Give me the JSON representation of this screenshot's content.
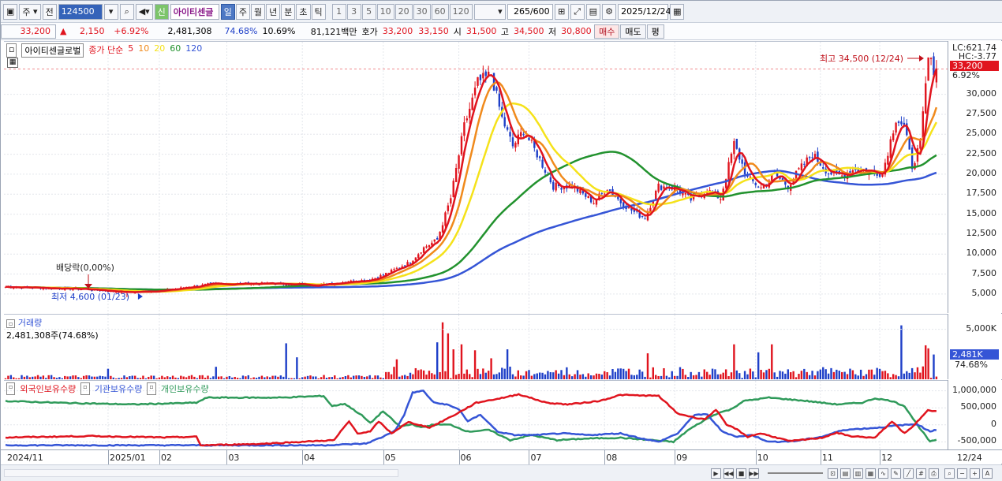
{
  "toolbar": {
    "kind_label": "주",
    "prev_label": "전",
    "code_value": "124500",
    "new_label": "신",
    "stock_name": "아이티센글",
    "periods": [
      "일",
      "주",
      "월",
      "년",
      "분",
      "초",
      "틱"
    ],
    "active_period": "일",
    "intervals": [
      "1",
      "3",
      "5",
      "10",
      "20",
      "30",
      "60",
      "120"
    ],
    "count_value": "265",
    "count_total": "/600",
    "date_value": "2025/12/24"
  },
  "quote": {
    "price": "33,200",
    "change_arrow": "▲",
    "change": "2,150",
    "change_pct": "+6.92%",
    "volume": "2,481,308",
    "vol_ratio": "74.68%",
    "turnover": "10.69%",
    "amount": "81,121백만",
    "hoga_label": "호가",
    "hoga_ask": "33,200",
    "hoga_bid": "33,150",
    "open_label": "시",
    "open": "31,500",
    "high_label": "고",
    "high": "34,500",
    "low_label": "저",
    "low": "30,800",
    "buy_label": "매수",
    "sell_label": "매도",
    "eval_label": "평"
  },
  "price_panel": {
    "title": "아이티센글로벌",
    "ma_prefix": "종가 단순",
    "ma_periods": [
      "5",
      "10",
      "20",
      "60",
      "120"
    ],
    "high_annotation": "최고 34,500 (12/24)",
    "low_annotation": "최저 4,600 (01/23)",
    "dividend_annotation": "배당락(0,00%)",
    "lc_label": "LC:621.74",
    "hc_label": "HC:-3.77",
    "last_price_badge": "33,200",
    "last_pct_badge": "6.92%"
  },
  "volume_panel": {
    "title": "거래량",
    "subtitle": "2,481,308주(74.68%)",
    "last_badge": "2,481K",
    "last_pct": "74.68%"
  },
  "holding_panel": {
    "legend": [
      "외국인보유수량",
      "기관보유수량",
      "개인보유수량"
    ]
  },
  "x_labels": [
    "2024/11",
    "2025/01",
    "02",
    "03",
    "04",
    "05",
    "06",
    "07",
    "08",
    "09",
    "10",
    "11",
    "12"
  ],
  "x_axis_right": "12/24",
  "colors": {
    "up": "#e0141e",
    "down": "#1e3fc8",
    "ma5": "#e0141e",
    "ma10": "#f08a1c",
    "ma20": "#f5e21a",
    "ma60": "#22922e",
    "ma120": "#3555d6",
    "foreign": "#e0141e",
    "inst": "#3555d6",
    "retail": "#2f9a5a"
  },
  "chart_data": {
    "type": "candlestick",
    "y_ticks": [
      5000,
      7500,
      10000,
      12500,
      15000,
      17500,
      20000,
      22500,
      25000,
      27500,
      30000
    ],
    "y_tick_labels": [
      "5,000",
      "7,500",
      "10,000",
      "12,500",
      "15,000",
      "17,500",
      "20,000",
      "22,500",
      "25,000",
      "27,500",
      "30,000"
    ],
    "ylim": [
      3800,
      35200
    ],
    "close_keypoints": [
      [
        0,
        5900
      ],
      [
        30,
        5600
      ],
      [
        45,
        5200
      ],
      [
        60,
        5500
      ],
      [
        75,
        6200
      ],
      [
        90,
        6300
      ],
      [
        100,
        6300
      ],
      [
        115,
        6100
      ],
      [
        125,
        6500
      ],
      [
        135,
        6800
      ],
      [
        140,
        7400
      ],
      [
        150,
        9000
      ],
      [
        155,
        10800
      ],
      [
        160,
        11800
      ],
      [
        165,
        17000
      ],
      [
        170,
        26000
      ],
      [
        175,
        31500
      ],
      [
        180,
        32500
      ],
      [
        184,
        27000
      ],
      [
        188,
        23500
      ],
      [
        192,
        25500
      ],
      [
        197,
        22500
      ],
      [
        203,
        18500
      ],
      [
        210,
        18500
      ],
      [
        218,
        16500
      ],
      [
        223,
        18300
      ],
      [
        228,
        16500
      ],
      [
        234,
        15000
      ],
      [
        237,
        14600
      ],
      [
        242,
        18500
      ],
      [
        248,
        18300
      ],
      [
        254,
        16800
      ],
      [
        260,
        18000
      ],
      [
        265,
        17000
      ],
      [
        270,
        23800
      ],
      [
        275,
        19500
      ],
      [
        280,
        18300
      ],
      [
        285,
        20000
      ],
      [
        290,
        18500
      ],
      [
        294,
        20500
      ],
      [
        299,
        22500
      ],
      [
        305,
        20200
      ],
      [
        310,
        19800
      ],
      [
        315,
        20700
      ],
      [
        320,
        20400
      ],
      [
        325,
        20100
      ],
      [
        330,
        27000
      ],
      [
        333,
        26000
      ],
      [
        336,
        21000
      ],
      [
        339,
        23800
      ],
      [
        341,
        31000
      ],
      [
        342,
        34500
      ],
      [
        344,
        33200
      ]
    ],
    "volume_ylim": [
      0,
      6000
    ],
    "volume_ticks": [
      5000
    ],
    "volume_tick_labels": [
      "5,000K"
    ],
    "volume_spikes": [
      [
        38,
        1050
      ],
      [
        78,
        1250
      ],
      [
        104,
        3600
      ],
      [
        108,
        2200
      ],
      [
        145,
        2000
      ],
      [
        160,
        3700
      ],
      [
        162,
        5700
      ],
      [
        164,
        4600
      ],
      [
        166,
        3000
      ],
      [
        169,
        3500
      ],
      [
        174,
        2900
      ],
      [
        180,
        2100
      ],
      [
        186,
        3000
      ],
      [
        238,
        2600
      ],
      [
        270,
        3500
      ],
      [
        279,
        2700
      ],
      [
        284,
        3500
      ],
      [
        332,
        5400
      ],
      [
        338,
        1200
      ],
      [
        341,
        3400
      ],
      [
        342,
        3100
      ],
      [
        344,
        2481
      ]
    ],
    "holding_ylim": [
      -700000,
      1200000
    ],
    "holding_ticks": [
      1000000,
      500000,
      0,
      -500000
    ],
    "holding_tick_labels": [
      "1,000,000",
      "500,000",
      "0",
      "-500,000"
    ],
    "foreign_keypoints": [
      [
        0,
        -370000
      ],
      [
        40,
        -330000
      ],
      [
        75,
        -370000
      ],
      [
        90,
        -350000
      ],
      [
        92,
        -600000
      ],
      [
        120,
        -560000
      ],
      [
        155,
        -450000
      ],
      [
        158,
        -200000
      ],
      [
        162,
        100000
      ],
      [
        166,
        -250000
      ],
      [
        172,
        -200000
      ],
      [
        176,
        100000
      ],
      [
        182,
        -250000
      ],
      [
        190,
        80000
      ],
      [
        200,
        -80000
      ],
      [
        212,
        300000
      ],
      [
        222,
        650000
      ],
      [
        235,
        800000
      ],
      [
        242,
        900000
      ],
      [
        255,
        650000
      ],
      [
        265,
        600000
      ],
      [
        280,
        700000
      ],
      [
        290,
        880000
      ],
      [
        308,
        850000
      ],
      [
        317,
        330000
      ],
      [
        326,
        200000
      ],
      [
        330,
        170000
      ],
      [
        335,
        450000
      ],
      [
        340,
        0
      ],
      [
        344,
        -100000
      ],
      [
        350,
        -350000
      ],
      [
        356,
        -250000
      ],
      [
        370,
        -480000
      ],
      [
        385,
        -380000
      ],
      [
        392,
        -230000
      ],
      [
        398,
        -330000
      ],
      [
        410,
        -380000
      ],
      [
        418,
        100000
      ],
      [
        424,
        -250000
      ],
      [
        428,
        -50000
      ],
      [
        435,
        450000
      ],
      [
        438,
        400000
      ]
    ],
    "inst_keypoints": [
      [
        0,
        -600000
      ],
      [
        150,
        -600000
      ],
      [
        170,
        -550000
      ],
      [
        178,
        -350000
      ],
      [
        184,
        -150000
      ],
      [
        188,
        300000
      ],
      [
        192,
        950000
      ],
      [
        197,
        1000000
      ],
      [
        202,
        650000
      ],
      [
        208,
        600000
      ],
      [
        214,
        450000
      ],
      [
        218,
        100000
      ],
      [
        224,
        300000
      ],
      [
        232,
        -200000
      ],
      [
        240,
        -300000
      ],
      [
        250,
        -300000
      ],
      [
        262,
        -250000
      ],
      [
        275,
        -300000
      ],
      [
        290,
        -250000
      ],
      [
        300,
        -400000
      ],
      [
        308,
        -500000
      ],
      [
        317,
        -250000
      ],
      [
        325,
        300000
      ],
      [
        331,
        300000
      ],
      [
        338,
        -200000
      ],
      [
        345,
        -350000
      ],
      [
        352,
        -300000
      ],
      [
        360,
        -500000
      ],
      [
        372,
        -480000
      ],
      [
        385,
        -350000
      ],
      [
        395,
        -150000
      ],
      [
        412,
        -80000
      ],
      [
        420,
        -20000
      ],
      [
        430,
        20000
      ],
      [
        436,
        -200000
      ],
      [
        438,
        -150000
      ]
    ],
    "retail_keypoints": [
      [
        0,
        700000
      ],
      [
        25,
        650000
      ],
      [
        60,
        600000
      ],
      [
        90,
        650000
      ],
      [
        95,
        800000
      ],
      [
        130,
        800000
      ],
      [
        150,
        850000
      ],
      [
        154,
        550000
      ],
      [
        160,
        620000
      ],
      [
        168,
        280000
      ],
      [
        172,
        50000
      ],
      [
        178,
        400000
      ],
      [
        186,
        -50000
      ],
      [
        192,
        20000
      ],
      [
        196,
        -80000
      ],
      [
        202,
        10000
      ],
      [
        210,
        0
      ],
      [
        218,
        -200000
      ],
      [
        228,
        -150000
      ],
      [
        238,
        -450000
      ],
      [
        248,
        -300000
      ],
      [
        260,
        -450000
      ],
      [
        275,
        -400000
      ],
      [
        290,
        -380000
      ],
      [
        305,
        -450000
      ],
      [
        315,
        -500000
      ],
      [
        322,
        -150000
      ],
      [
        330,
        150000
      ],
      [
        336,
        350000
      ],
      [
        342,
        450000
      ],
      [
        348,
        700000
      ],
      [
        360,
        800000
      ],
      [
        378,
        700000
      ],
      [
        392,
        600000
      ],
      [
        404,
        650000
      ],
      [
        410,
        780000
      ],
      [
        418,
        700000
      ],
      [
        424,
        550000
      ],
      [
        430,
        0
      ],
      [
        436,
        -500000
      ],
      [
        438,
        -450000
      ]
    ]
  }
}
